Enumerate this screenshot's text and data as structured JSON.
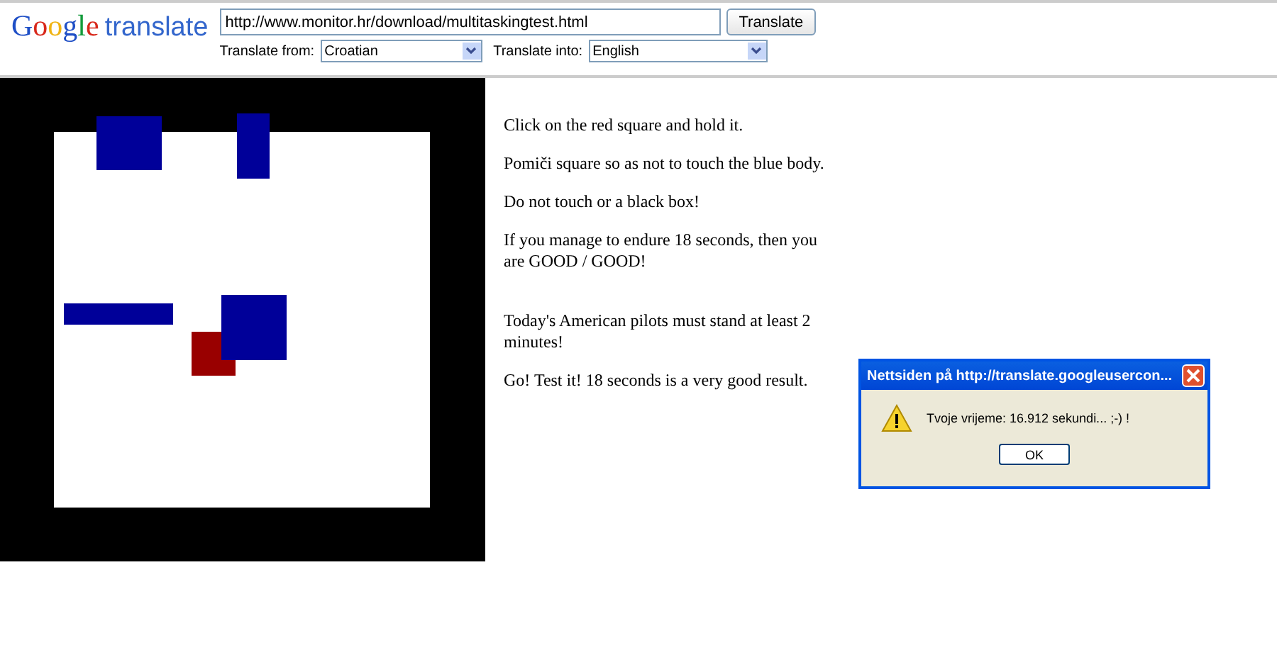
{
  "header": {
    "logo_brand": "Google",
    "logo_product": "translate",
    "url": "http://www.monitor.hr/download/multitaskingtest.html",
    "button": "Translate",
    "from_label": "Translate from:",
    "from_value": "Croatian",
    "into_label": "Translate into:",
    "into_value": "English"
  },
  "paragraphs": [
    "Click on the red square and hold it.",
    "Pomiči square so as not to touch the blue body.",
    "Do not touch or a black box!",
    "If you manage to endure 18 seconds, then you are GOOD / GOOD!",
    "Today's American pilots must stand at least 2 minutes!",
    "Go! Test it! 18 seconds is a very good result."
  ],
  "dialog": {
    "title": "Nettsiden på http://translate.googleusercon...",
    "message": "Tvoje vrijeme: 16.912 sekundi... ;-) !",
    "button": "OK"
  }
}
